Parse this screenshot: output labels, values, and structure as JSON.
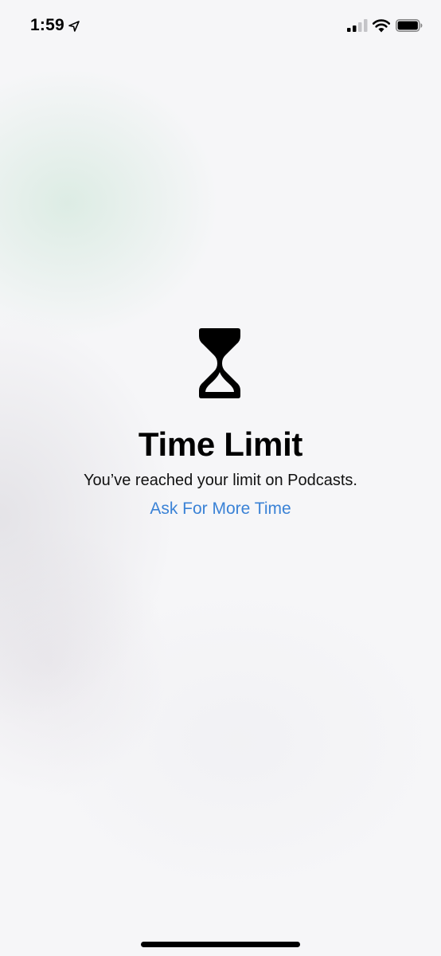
{
  "status_bar": {
    "time": "1:59",
    "location_icon": "location-arrow-icon",
    "signal_icon": "cellular-signal-icon",
    "wifi_icon": "wifi-icon",
    "battery_icon": "battery-icon"
  },
  "content": {
    "icon": "hourglass-icon",
    "title": "Time Limit",
    "message": "You’ve reached your limit on Podcasts.",
    "ask_button_label": "Ask For More Time"
  },
  "colors": {
    "link": "#3a82d6",
    "text": "#000000",
    "background": "#f6f6f8"
  }
}
